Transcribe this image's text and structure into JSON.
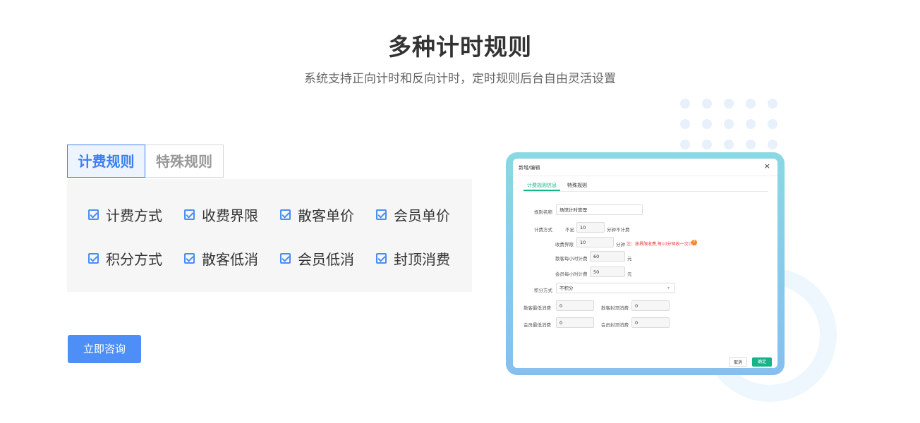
{
  "header": {
    "title": "多种计时规则",
    "subtitle": "系统支持正向计时和反向计时，定时规则后台自由灵活设置"
  },
  "tabs": [
    {
      "label": "计费规则",
      "active": true
    },
    {
      "label": "特殊规则",
      "active": false
    }
  ],
  "features": [
    "计费方式",
    "收费界限",
    "散客单价",
    "会员单价",
    "积分方式",
    "散客低消",
    "会员低消",
    "封顶消费"
  ],
  "cta_label": "立即咨询",
  "dialog": {
    "title": "新增/编辑",
    "close": "×",
    "tabs": [
      "计费规则信息",
      "特殊规则"
    ],
    "rule_name_label": "规则名称",
    "rule_name_value": "场馆计时管理",
    "billing_method_label": "计费方式",
    "under_text": "不足",
    "under_value": "10",
    "minutes_free_text": "分钟不计费",
    "limit_label": "收费界限",
    "limit_value": "10",
    "limit_unit": "分钟",
    "limit_note": "注：按界限收费,每10分钟收一次计费",
    "note_icon": "?",
    "guest_hourly_label": "散客每小时计费",
    "guest_hourly_value": "60",
    "member_hourly_label": "会员每小时计费",
    "member_hourly_value": "50",
    "yuan": "元",
    "points_label": "积分方式",
    "points_value": "不积分",
    "guest_min_label": "散客最低消费",
    "guest_min_value": "0",
    "guest_cap_label": "散客封顶消费",
    "guest_cap_value": "0",
    "member_min_label": "会员最低消费",
    "member_min_value": "0",
    "member_cap_label": "会员封顶消费",
    "member_cap_value": "0",
    "cancel_label": "取消",
    "ok_label": "确定"
  },
  "colors": {
    "accent": "#3d7ff2",
    "dialog_accent": "#17b48a"
  }
}
